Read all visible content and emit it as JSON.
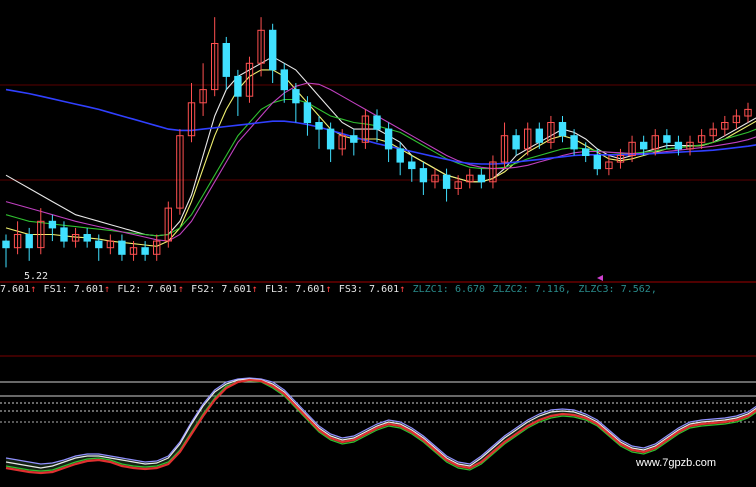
{
  "colors": {
    "background": "#000000",
    "candle_up": "#ff5050",
    "candle_down": "#40e0ff",
    "ma_white": "#e8e8e8",
    "ma_yellow": "#f0f070",
    "ma_green": "#30c030",
    "ma_magenta": "#c040c0",
    "ma_blue": "#3040ff",
    "sep_line": "#a00000",
    "grid": "#5a0000",
    "osc_red": "#e03030",
    "osc_white": "#e8e8e8",
    "osc_blue": "#9090ff",
    "osc_green": "#30c030",
    "legend_red_label": "#ff4040",
    "legend_zl": "#2a8c8c",
    "legend_white": "#e8e8e8"
  },
  "price_label": "5.22",
  "legend": [
    {
      "label": "7.601",
      "arrow": "↑",
      "color": "legend_red_label",
      "kind": "value"
    },
    {
      "label": "FS1:",
      "value": "7.601",
      "arrow": "↑"
    },
    {
      "label": "FL2:",
      "value": "7.601",
      "arrow": "↑"
    },
    {
      "label": "FS2:",
      "value": "7.601",
      "arrow": "↑"
    },
    {
      "label": "FL3:",
      "value": "7.601",
      "arrow": "↑"
    },
    {
      "label": "FS3:",
      "value": "7.601",
      "arrow": "↑"
    },
    {
      "label": "ZLZC1:",
      "value": "6.670"
    },
    {
      "label": "ZLZC2:",
      "value": "7.116,"
    },
    {
      "label": "ZLZC3:",
      "value": "7.562,"
    }
  ],
  "watermark": "www.7gpzb.com",
  "chart_data": {
    "type": "candlestick",
    "candles": [
      {
        "o": 5.6,
        "c": 5.5,
        "h": 5.7,
        "l": 5.2
      },
      {
        "o": 5.5,
        "c": 5.7,
        "h": 5.9,
        "l": 5.4
      },
      {
        "o": 5.7,
        "c": 5.5,
        "h": 5.8,
        "l": 5.3
      },
      {
        "o": 5.5,
        "c": 5.9,
        "h": 6.1,
        "l": 5.4
      },
      {
        "o": 5.9,
        "c": 5.8,
        "h": 6.0,
        "l": 5.6
      },
      {
        "o": 5.8,
        "c": 5.6,
        "h": 5.9,
        "l": 5.5
      },
      {
        "o": 5.6,
        "c": 5.7,
        "h": 5.8,
        "l": 5.5
      },
      {
        "o": 5.7,
        "c": 5.6,
        "h": 5.8,
        "l": 5.5
      },
      {
        "o": 5.6,
        "c": 5.5,
        "h": 5.7,
        "l": 5.3
      },
      {
        "o": 5.5,
        "c": 5.6,
        "h": 5.7,
        "l": 5.4
      },
      {
        "o": 5.6,
        "c": 5.4,
        "h": 5.7,
        "l": 5.3
      },
      {
        "o": 5.4,
        "c": 5.5,
        "h": 5.6,
        "l": 5.3
      },
      {
        "o": 5.5,
        "c": 5.4,
        "h": 5.6,
        "l": 5.3
      },
      {
        "o": 5.4,
        "c": 5.6,
        "h": 5.7,
        "l": 5.3
      },
      {
        "o": 5.6,
        "c": 6.1,
        "h": 6.2,
        "l": 5.5
      },
      {
        "o": 6.1,
        "c": 7.2,
        "h": 7.3,
        "l": 6.0
      },
      {
        "o": 7.2,
        "c": 7.7,
        "h": 8.0,
        "l": 7.1
      },
      {
        "o": 7.7,
        "c": 7.9,
        "h": 8.3,
        "l": 7.5
      },
      {
        "o": 7.9,
        "c": 8.6,
        "h": 9.0,
        "l": 7.8
      },
      {
        "o": 8.6,
        "c": 8.1,
        "h": 8.7,
        "l": 7.9
      },
      {
        "o": 8.1,
        "c": 7.8,
        "h": 8.2,
        "l": 7.5
      },
      {
        "o": 7.8,
        "c": 8.3,
        "h": 8.4,
        "l": 7.7
      },
      {
        "o": 8.3,
        "c": 8.8,
        "h": 9.0,
        "l": 8.1
      },
      {
        "o": 8.8,
        "c": 8.2,
        "h": 8.9,
        "l": 8.0
      },
      {
        "o": 8.2,
        "c": 7.9,
        "h": 8.3,
        "l": 7.7
      },
      {
        "o": 7.9,
        "c": 7.7,
        "h": 8.0,
        "l": 7.4
      },
      {
        "o": 7.7,
        "c": 7.4,
        "h": 7.8,
        "l": 7.2
      },
      {
        "o": 7.4,
        "c": 7.3,
        "h": 7.5,
        "l": 7.0
      },
      {
        "o": 7.3,
        "c": 7.0,
        "h": 7.4,
        "l": 6.8
      },
      {
        "o": 7.0,
        "c": 7.2,
        "h": 7.3,
        "l": 6.9
      },
      {
        "o": 7.2,
        "c": 7.1,
        "h": 7.3,
        "l": 6.9
      },
      {
        "o": 7.1,
        "c": 7.5,
        "h": 7.6,
        "l": 7.0
      },
      {
        "o": 7.5,
        "c": 7.3,
        "h": 7.6,
        "l": 7.1
      },
      {
        "o": 7.3,
        "c": 7.0,
        "h": 7.4,
        "l": 6.8
      },
      {
        "o": 7.0,
        "c": 6.8,
        "h": 7.1,
        "l": 6.6
      },
      {
        "o": 6.8,
        "c": 6.7,
        "h": 6.9,
        "l": 6.5
      },
      {
        "o": 6.7,
        "c": 6.5,
        "h": 6.8,
        "l": 6.3
      },
      {
        "o": 6.5,
        "c": 6.6,
        "h": 6.7,
        "l": 6.4
      },
      {
        "o": 6.6,
        "c": 6.4,
        "h": 6.7,
        "l": 6.2
      },
      {
        "o": 6.4,
        "c": 6.5,
        "h": 6.6,
        "l": 6.3
      },
      {
        "o": 6.5,
        "c": 6.6,
        "h": 6.7,
        "l": 6.4
      },
      {
        "o": 6.6,
        "c": 6.5,
        "h": 6.7,
        "l": 6.4
      },
      {
        "o": 6.5,
        "c": 6.8,
        "h": 6.9,
        "l": 6.4
      },
      {
        "o": 6.8,
        "c": 7.2,
        "h": 7.4,
        "l": 6.7
      },
      {
        "o": 7.2,
        "c": 7.0,
        "h": 7.3,
        "l": 6.9
      },
      {
        "o": 7.0,
        "c": 7.3,
        "h": 7.4,
        "l": 6.9
      },
      {
        "o": 7.3,
        "c": 7.1,
        "h": 7.4,
        "l": 7.0
      },
      {
        "o": 7.1,
        "c": 7.4,
        "h": 7.5,
        "l": 7.0
      },
      {
        "o": 7.4,
        "c": 7.2,
        "h": 7.5,
        "l": 7.1
      },
      {
        "o": 7.2,
        "c": 7.0,
        "h": 7.3,
        "l": 6.9
      },
      {
        "o": 7.0,
        "c": 6.9,
        "h": 7.1,
        "l": 6.8
      },
      {
        "o": 6.9,
        "c": 6.7,
        "h": 7.0,
        "l": 6.6
      },
      {
        "o": 6.7,
        "c": 6.8,
        "h": 6.9,
        "l": 6.6
      },
      {
        "o": 6.8,
        "c": 6.9,
        "h": 7.0,
        "l": 6.7
      },
      {
        "o": 6.9,
        "c": 7.1,
        "h": 7.2,
        "l": 6.8
      },
      {
        "o": 7.1,
        "c": 7.0,
        "h": 7.2,
        "l": 6.9
      },
      {
        "o": 7.0,
        "c": 7.2,
        "h": 7.3,
        "l": 6.9
      },
      {
        "o": 7.2,
        "c": 7.1,
        "h": 7.3,
        "l": 7.0
      },
      {
        "o": 7.1,
        "c": 7.0,
        "h": 7.2,
        "l": 6.9
      },
      {
        "o": 7.0,
        "c": 7.1,
        "h": 7.2,
        "l": 6.9
      },
      {
        "o": 7.1,
        "c": 7.2,
        "h": 7.3,
        "l": 7.0
      },
      {
        "o": 7.2,
        "c": 7.3,
        "h": 7.4,
        "l": 7.1
      },
      {
        "o": 7.3,
        "c": 7.4,
        "h": 7.5,
        "l": 7.2
      },
      {
        "o": 7.4,
        "c": 7.5,
        "h": 7.6,
        "l": 7.3
      },
      {
        "o": 7.5,
        "c": 7.6,
        "h": 7.7,
        "l": 7.4
      }
    ],
    "y_range": [
      5.1,
      9.2
    ],
    "ma_lines": [
      {
        "color": "ma_white",
        "values": [
          6.6,
          6.5,
          6.4,
          6.3,
          6.2,
          6.1,
          6.0,
          5.95,
          5.9,
          5.85,
          5.8,
          5.75,
          5.7,
          5.68,
          5.7,
          5.9,
          6.3,
          6.9,
          7.5,
          7.9,
          8.1,
          8.2,
          8.3,
          8.4,
          8.3,
          8.2,
          8.0,
          7.8,
          7.6,
          7.4,
          7.3,
          7.3,
          7.3,
          7.2,
          7.1,
          6.9,
          6.8,
          6.7,
          6.6,
          6.55,
          6.5,
          6.5,
          6.55,
          6.7,
          6.9,
          7.0,
          7.1,
          7.2,
          7.3,
          7.25,
          7.15,
          7.0,
          6.9,
          6.85,
          6.9,
          6.95,
          7.0,
          7.05,
          7.05,
          7.05,
          7.05,
          7.1,
          7.2,
          7.3,
          7.4,
          7.5
        ]
      },
      {
        "color": "ma_yellow",
        "values": [
          5.8,
          5.75,
          5.7,
          5.7,
          5.7,
          5.68,
          5.66,
          5.65,
          5.63,
          5.6,
          5.58,
          5.56,
          5.54,
          5.52,
          5.6,
          5.8,
          6.2,
          6.7,
          7.2,
          7.6,
          7.9,
          8.1,
          8.2,
          8.2,
          8.1,
          7.9,
          7.7,
          7.5,
          7.3,
          7.2,
          7.15,
          7.15,
          7.15,
          7.1,
          7.0,
          6.9,
          6.8,
          6.7,
          6.6,
          6.55,
          6.5,
          6.5,
          6.55,
          6.65,
          6.8,
          6.95,
          7.05,
          7.15,
          7.2,
          7.15,
          7.05,
          6.95,
          6.85,
          6.82,
          6.85,
          6.9,
          6.95,
          7.0,
          7.02,
          7.04,
          7.05,
          7.1,
          7.15,
          7.25,
          7.35,
          7.45
        ]
      },
      {
        "color": "ma_green",
        "values": [
          6.0,
          5.95,
          5.9,
          5.88,
          5.86,
          5.84,
          5.82,
          5.8,
          5.78,
          5.76,
          5.74,
          5.72,
          5.7,
          5.68,
          5.7,
          5.8,
          6.0,
          6.3,
          6.6,
          6.9,
          7.2,
          7.4,
          7.6,
          7.7,
          7.75,
          7.75,
          7.7,
          7.6,
          7.5,
          7.45,
          7.4,
          7.38,
          7.35,
          7.3,
          7.25,
          7.15,
          7.05,
          6.95,
          6.85,
          6.78,
          6.72,
          6.7,
          6.7,
          6.72,
          6.78,
          6.85,
          6.9,
          6.95,
          7.0,
          7.02,
          7.0,
          6.97,
          6.95,
          6.93,
          6.93,
          6.95,
          6.97,
          7.0,
          7.02,
          7.04,
          7.06,
          7.1,
          7.15,
          7.2,
          7.25,
          7.32
        ]
      },
      {
        "color": "ma_magenta",
        "values": [
          6.2,
          6.15,
          6.1,
          6.05,
          6.0,
          5.95,
          5.9,
          5.86,
          5.82,
          5.78,
          5.74,
          5.7,
          5.66,
          5.62,
          5.6,
          5.7,
          5.9,
          6.2,
          6.5,
          6.8,
          7.1,
          7.3,
          7.5,
          7.7,
          7.85,
          7.95,
          8.0,
          7.98,
          7.9,
          7.8,
          7.7,
          7.6,
          7.5,
          7.4,
          7.3,
          7.2,
          7.1,
          7.0,
          6.9,
          6.82,
          6.76,
          6.72,
          6.7,
          6.7,
          6.72,
          6.75,
          6.8,
          6.85,
          6.9,
          6.94,
          6.96,
          6.96,
          6.95,
          6.94,
          6.93,
          6.93,
          6.94,
          6.96,
          6.98,
          7.0,
          7.02,
          7.04,
          7.07,
          7.1,
          7.14,
          7.2
        ]
      },
      {
        "color": "ma_blue",
        "values": [
          7.9,
          7.87,
          7.84,
          7.8,
          7.76,
          7.72,
          7.68,
          7.64,
          7.6,
          7.55,
          7.5,
          7.45,
          7.4,
          7.35,
          7.3,
          7.28,
          7.28,
          7.3,
          7.32,
          7.34,
          7.36,
          7.38,
          7.4,
          7.42,
          7.42,
          7.4,
          7.37,
          7.33,
          7.28,
          7.23,
          7.18,
          7.13,
          7.08,
          7.04,
          7.0,
          6.96,
          6.92,
          6.88,
          6.84,
          6.8,
          6.78,
          6.77,
          6.77,
          6.78,
          6.8,
          6.82,
          6.84,
          6.86,
          6.88,
          6.9,
          6.91,
          6.91,
          6.91,
          6.91,
          6.91,
          6.92,
          6.93,
          6.94,
          6.95,
          6.96,
          6.97,
          6.98,
          7.0,
          7.02,
          7.04,
          7.07
        ]
      }
    ],
    "oscillator": {
      "y_range": [
        0,
        100
      ],
      "red": [
        10,
        8,
        6,
        5,
        6,
        10,
        14,
        17,
        18,
        16,
        12,
        10,
        9,
        10,
        14,
        26,
        44,
        62,
        78,
        90,
        96,
        98,
        97,
        92,
        84,
        72,
        60,
        48,
        40,
        36,
        38,
        44,
        50,
        54,
        52,
        46,
        38,
        28,
        18,
        12,
        10,
        16,
        26,
        36,
        44,
        52,
        58,
        62,
        64,
        63,
        60,
        54,
        44,
        34,
        28,
        26,
        30,
        38,
        46,
        52,
        54,
        55,
        56,
        58,
        62,
        70
      ],
      "white": [
        16,
        14,
        12,
        10,
        12,
        16,
        20,
        22,
        22,
        20,
        18,
        16,
        14,
        15,
        20,
        34,
        54,
        72,
        86,
        94,
        98,
        99,
        98,
        94,
        86,
        74,
        62,
        50,
        42,
        38,
        40,
        46,
        52,
        56,
        54,
        48,
        40,
        30,
        20,
        14,
        12,
        20,
        30,
        40,
        48,
        56,
        62,
        66,
        67,
        66,
        62,
        56,
        46,
        36,
        30,
        28,
        32,
        40,
        48,
        54,
        56,
        57,
        58,
        60,
        64,
        72
      ],
      "blue": [
        20,
        18,
        16,
        14,
        15,
        18,
        22,
        24,
        24,
        22,
        20,
        18,
        16,
        17,
        22,
        36,
        56,
        74,
        88,
        96,
        99,
        100,
        99,
        96,
        88,
        76,
        64,
        52,
        44,
        40,
        42,
        48,
        54,
        58,
        56,
        50,
        42,
        32,
        22,
        16,
        14,
        22,
        32,
        42,
        50,
        58,
        64,
        68,
        69,
        68,
        64,
        58,
        48,
        38,
        32,
        30,
        34,
        42,
        50,
        56,
        58,
        59,
        60,
        62,
        66,
        74
      ],
      "green": [
        12,
        10,
        8,
        7,
        8,
        12,
        16,
        19,
        20,
        18,
        14,
        12,
        11,
        12,
        16,
        28,
        46,
        64,
        80,
        92,
        96,
        97,
        96,
        90,
        82,
        70,
        58,
        46,
        38,
        34,
        36,
        42,
        48,
        52,
        50,
        44,
        36,
        26,
        16,
        10,
        8,
        14,
        24,
        34,
        42,
        50,
        56,
        60,
        62,
        61,
        58,
        52,
        42,
        32,
        26,
        24,
        28,
        36,
        44,
        50,
        52,
        53,
        54,
        56,
        60,
        68
      ]
    }
  }
}
